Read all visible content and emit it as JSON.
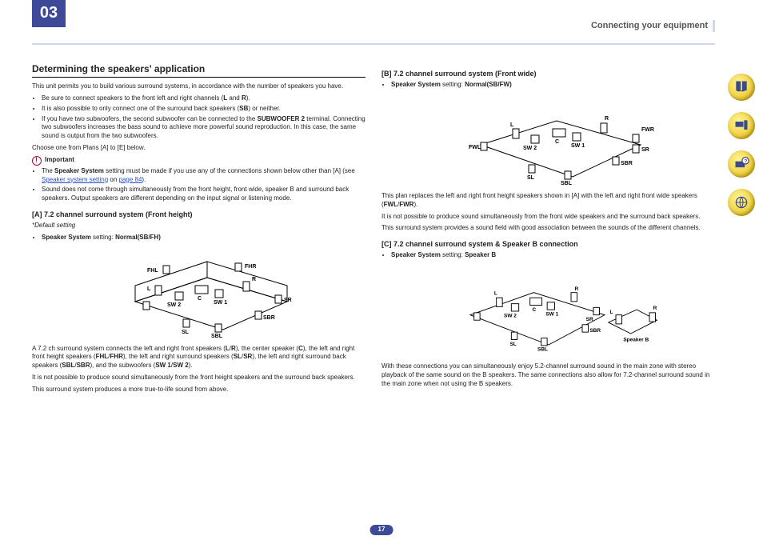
{
  "header": {
    "chapter": "03",
    "section": "Connecting your equipment"
  },
  "page_number": "17",
  "left": {
    "h1": "Determining the speakers' application",
    "intro": "This unit permits you to build various surround systems, in accordance with the number of speakers you have.",
    "bullets": [
      {
        "pre": "Be sure to connect speakers to the front left and right channels (",
        "b1": "L",
        "mid": " and ",
        "b2": "R",
        "post": ")."
      },
      {
        "pre": "It is also possible to only connect one of the surround back speakers (",
        "b1": "SB",
        "post": ") or neither."
      },
      {
        "pre": "If you have two subwoofers, the second subwoofer can be connected to the ",
        "b1": "SUBWOOFER 2",
        "post": " terminal. Connecting two subwoofers increases the bass sound to achieve more powerful sound reproduction. In this case, the same sound is output from the two subwoofers."
      }
    ],
    "choose": "Choose one from Plans [A] to [E] below.",
    "important_h": "Important",
    "imp": [
      {
        "pre": "The ",
        "b1": "Speaker System",
        "mid": " setting must be made if you use any of the connections shown below other than [A] (see ",
        "link": "Speaker system setting",
        "link2": " on ",
        "link3": "page 84",
        "post": ")."
      },
      {
        "text": "Sound does not come through simultaneously from the front height, front wide, speaker B and surround back speakers. Output speakers are different depending on the input signal or listening mode."
      }
    ],
    "a_title": "[A] 7.2 channel surround system (Front height)",
    "a_default": "*Default setting",
    "a_set_pre": "Speaker System",
    "a_set_mid": " setting: ",
    "a_set_val": "Normal(SB/FH)",
    "a_desc": {
      "p1a": "A 7.2 ch surround system connects the left and right front speakers (",
      "p1b": "L",
      "p1c": "/",
      "p1d": "R",
      "p1e": "), the center speaker (",
      "p1f": "C",
      "p1g": "), the left and right front height speakers (",
      "p1h": "FHL",
      "p1i": "/",
      "p1j": "FHR",
      "p1k": "), the left and right surround speakers (",
      "p1l": "SL",
      "p1m": "/",
      "p1n": "SR",
      "p1o": "), the left and right surround back speakers (",
      "p1p": "SBL",
      "p1q": "/",
      "p1r": "SBR",
      "p1s": "), and the subwoofers (",
      "p1t": "SW 1",
      "p1u": "/",
      "p1v": "SW 2",
      "p1w": ").",
      "p2": "It is not possible to produce sound simultaneously from the front height speakers and the surround back speakers.",
      "p3": "This surround system produces a more true-to-life sound from above."
    },
    "diagA": {
      "FHL": "FHL",
      "FHR": "FHR",
      "L": "L",
      "R": "R",
      "C": "C",
      "SW1": "SW 1",
      "SW2": "SW 2",
      "SL": "SL",
      "SR": "SR",
      "SBL": "SBL",
      "SBR": "SBR"
    }
  },
  "right": {
    "b_title": "[B] 7.2 channel surround system (Front wide)",
    "b_set_pre": "Speaker System",
    "b_set_mid": " setting: ",
    "b_set_val": "Normal(SB/FW)",
    "b_desc": {
      "p1a": "This plan replaces the left and right front height speakers shown in [A] with the left and right front wide speakers (",
      "p1b": "FWL",
      "p1c": "/",
      "p1d": "FWR",
      "p1e": ").",
      "p2": "It is not possible to produce sound simultaneously from the front wide speakers and the surround back speakers.",
      "p3": "This surround system provides a sound field with good association between the sounds of the different channels."
    },
    "diagB": {
      "FWL": "FWL",
      "FWR": "FWR",
      "L": "L",
      "R": "R",
      "C": "C",
      "SW1": "SW 1",
      "SW2": "SW 2",
      "SL": "SL",
      "SR": "SR",
      "SBL": "SBL",
      "SBR": "SBR"
    },
    "c_title": "[C] 7.2 channel surround system & Speaker B connection",
    "c_set_pre": "Speaker System",
    "c_set_mid": " setting: ",
    "c_set_val": "Speaker B",
    "c_desc": "With these connections you can simultaneously enjoy 5.2-channel surround sound in the main zone with stereo playback of the same sound on the B speakers. The same connections also allow for 7.2-channel surround sound in the main zone when not using the B speakers.",
    "diagC": {
      "L": "L",
      "R": "R",
      "C": "C",
      "SW1": "SW 1",
      "SW2": "SW 2",
      "SL": "SL",
      "SR": "SR",
      "SBL": "SBL",
      "SBR": "SBR",
      "BL": "L",
      "BR": "R",
      "BLBL": "Speaker B"
    }
  },
  "side_icons": [
    "book-icon",
    "setup-icon",
    "help-icon",
    "network-icon"
  ]
}
